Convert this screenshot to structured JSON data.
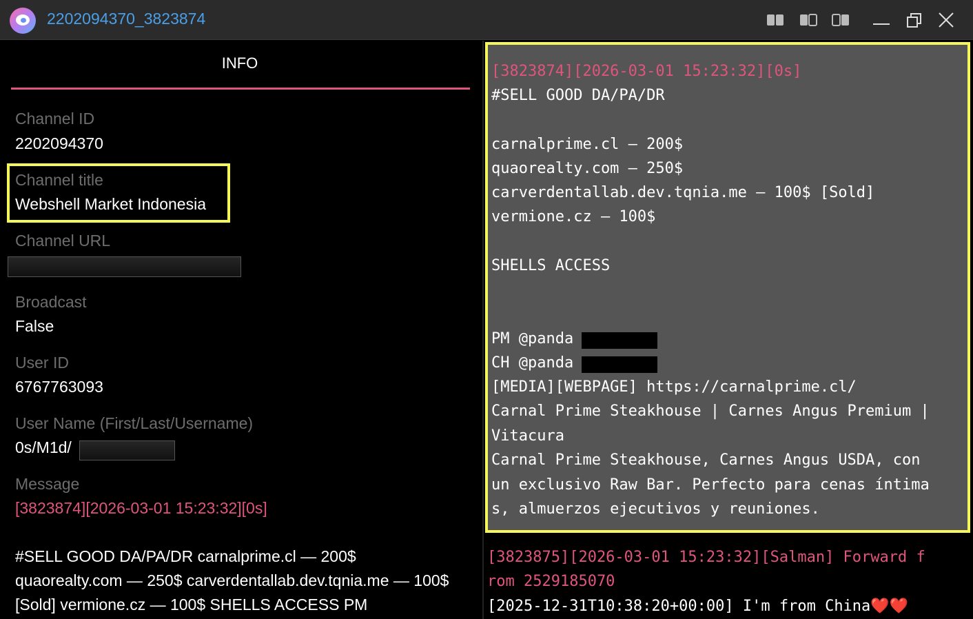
{
  "window": {
    "title": "2202094370_3823874"
  },
  "left_panel": {
    "tab_label": "INFO",
    "fields": {
      "channel_id": {
        "label": "Channel ID",
        "value": "2202094370"
      },
      "channel_title": {
        "label": "Channel title",
        "value": "Webshell Market Indonesia"
      },
      "channel_url": {
        "label": "Channel URL"
      },
      "broadcast": {
        "label": "Broadcast",
        "value": "False"
      },
      "user_id": {
        "label": "User ID",
        "value": "6767763093"
      },
      "user_name": {
        "label": "User Name (First/Last/Username)",
        "value": "0s/M1d/"
      },
      "message": {
        "label": "Message",
        "header": "[3823874][2026-03-01 15:23:32][0s]",
        "body_lines": [
          "#SELL GOOD DA/PA/DR carnalprime.cl — 200$",
          "quaorealty.com — 250$ carverdentallab.dev.tqnia.me — 100$",
          "[Sold] vermione.cz — 100$ SHELLS ACCESS PM"
        ]
      }
    }
  },
  "right_panel": {
    "highlighted_message": {
      "header": "[3823874][2026-03-01 15:23:32][0s]",
      "lines": [
        "#SELL GOOD DA/PA/DR",
        "carnalprime.cl — 200$",
        "quaorealty.com — 250$",
        "carverdentallab.dev.tqnia.me — 100$ [Sold]",
        "vermione.cz — 100$",
        "SHELLS ACCESS",
        "PM @panda",
        "CH @panda",
        "[MEDIA][WEBPAGE] https://carnalprime.cl/",
        "Carnal Prime Steakhouse | Carnes Angus Premium |",
        "Vitacura",
        "Carnal Prime Steakhouse, Carnes Angus USDA, con",
        "un exclusivo Raw Bar. Perfecto para cenas íntima",
        "s, almuerzos ejecutivos y reuniones."
      ]
    },
    "next_message": {
      "header_line1": "[3823875][2026-03-01 15:23:32][Salman] Forward f",
      "header_line2": "rom 2529185070",
      "body": "[2025-12-31T10:38:20+00:00] I'm from China",
      "emoji": "❤️❤️"
    }
  },
  "colors": {
    "accent": "#e0557b",
    "highlight": "#f4f65a",
    "title": "#4a9fe8"
  },
  "icons": [
    "app-logo-icon",
    "layout-left-icon",
    "layout-split-icon",
    "layout-right-icon",
    "minimize-icon",
    "restore-icon",
    "close-icon"
  ]
}
